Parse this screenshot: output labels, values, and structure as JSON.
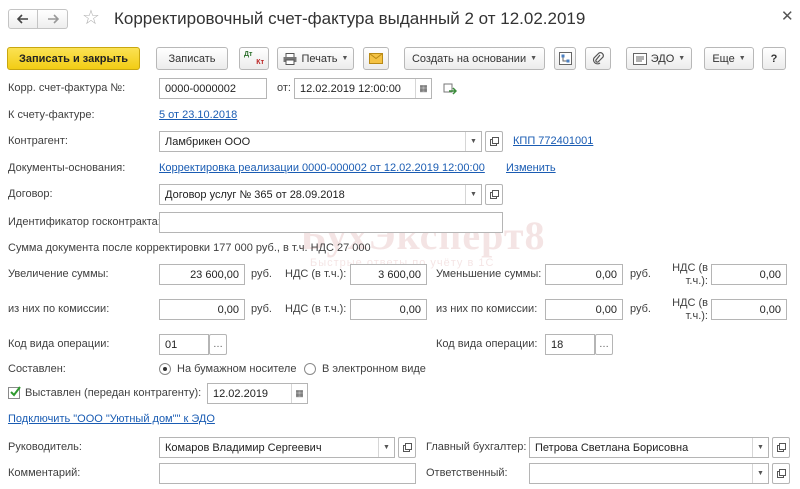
{
  "title": "Корректировочный счет-фактура выданный 2 от 12.02.2019",
  "toolbar": {
    "save_close": "Записать и закрыть",
    "save": "Записать",
    "dt_kt_top": "Дт",
    "dt_kt_bottom": "Кт",
    "print": "Печать",
    "create_based": "Создать на основании",
    "edo": "ЭДО",
    "more": "Еще",
    "help": "?"
  },
  "form": {
    "corr_invoice_label": "Корр. счет-фактура №:",
    "corr_invoice_number": "0000-0000002",
    "date_from_label": "от:",
    "date_from": "12.02.2019 12:00:00",
    "to_invoice_label": "К счету-фактуре:",
    "to_invoice_link": "5 от 23.10.2018",
    "contractor_label": "Контрагент:",
    "contractor": "Ламбрикен ООО",
    "kpp_link": "КПП 772401001",
    "base_docs_label": "Документы-основания:",
    "base_docs_link": "Корректировка реализации 0000-000002 от 12.02.2019 12:00:00",
    "change_link": "Изменить",
    "contract_label": "Договор:",
    "contract": "Договор услуг № 365 от 28.09.2018",
    "gov_contract_label": "Идентификатор госконтракта:",
    "gov_contract": "",
    "sum_after_text": "Сумма документа после корректировки 177 000 руб., в т.ч. НДС 27 000",
    "increase_label": "Увеличение суммы:",
    "increase_value": "23 600,00",
    "unit_rub": "руб.",
    "vat_incl_label": "НДС (в т.ч.):",
    "increase_vat": "3 600,00",
    "decrease_label": "Уменьшение суммы:",
    "decrease_value": "0,00",
    "decrease_vat_label_line1": "НДС (в",
    "decrease_vat_label_line2": "т.ч.):",
    "decrease_vat": "0,00",
    "commission_label": "из них по комиссии:",
    "commission_value": "0,00",
    "commission_vat": "0,00",
    "commission_label_right": "из них по комиссии:",
    "commission_value_right": "0,00",
    "commission_vat_right": "0,00",
    "op_code_label": "Код вида операции:",
    "op_code": "01",
    "op_code_label_right": "Код вида операции:",
    "op_code_right": "18",
    "composed_label": "Составлен:",
    "radio_paper": "На бумажном носителе",
    "radio_electronic": "В электронном виде",
    "issued_label": "Выставлен (передан контрагенту):",
    "issued_date": "12.02.2019",
    "connect_edo_link": "Подключить \"ООО \"Уютный дом\"\" к ЭДО",
    "director_label": "Руководитель:",
    "director": "Комаров Владимир Сергеевич",
    "chief_accountant_label": "Главный бухгалтер:",
    "chief_accountant": "Петрова Светлана Борисовна",
    "comment_label": "Комментарий:",
    "comment": "",
    "responsible_label": "Ответственный:",
    "responsible": ""
  },
  "watermark": {
    "main": "БухЭксперт8",
    "sub": "Быстрые ответы по учёту в 1С"
  },
  "colors": {
    "accent_button": "#f5d626",
    "link": "#1a5cb3",
    "checkbox": "#2f9a2f"
  }
}
